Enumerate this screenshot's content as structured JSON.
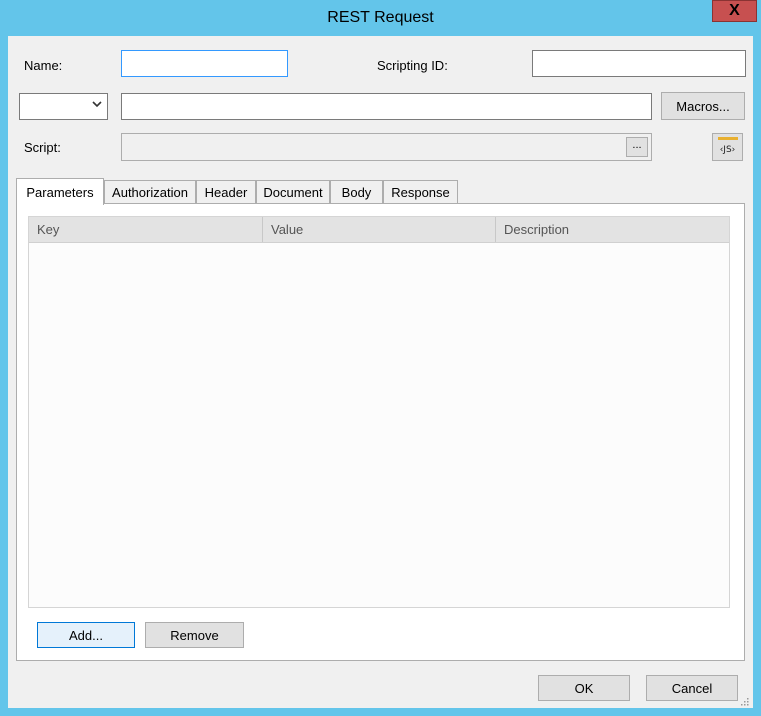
{
  "window": {
    "title": "REST Request",
    "close_glyph": "X"
  },
  "form": {
    "name_label": "Name:",
    "name_value": "",
    "scripting_id_label": "Scripting ID:",
    "scripting_id_value": "",
    "method_selected": "",
    "url_value": "",
    "macros_label": "Macros...",
    "script_label": "Script:",
    "script_value": "",
    "script_browse_label": "...",
    "js_icon_text": "‹JS›"
  },
  "tabs": [
    "Parameters",
    "Authorization",
    "Header",
    "Document",
    "Body",
    "Response"
  ],
  "active_tab": "Parameters",
  "parameters": {
    "columns": [
      "Key",
      "Value",
      "Description"
    ],
    "rows": [],
    "add_label": "Add...",
    "remove_label": "Remove"
  },
  "footer": {
    "ok_label": "OK",
    "cancel_label": "Cancel"
  },
  "colors": {
    "title_bar": "#63c5ea",
    "close_button": "#c75050",
    "dialog_bg": "#f0f0f0",
    "js_accent": "#e8b030"
  },
  "icons": {
    "close": "close-icon",
    "dropdown": "chevron-down-icon",
    "javascript": "javascript-icon",
    "resize": "resize-grip-icon"
  }
}
